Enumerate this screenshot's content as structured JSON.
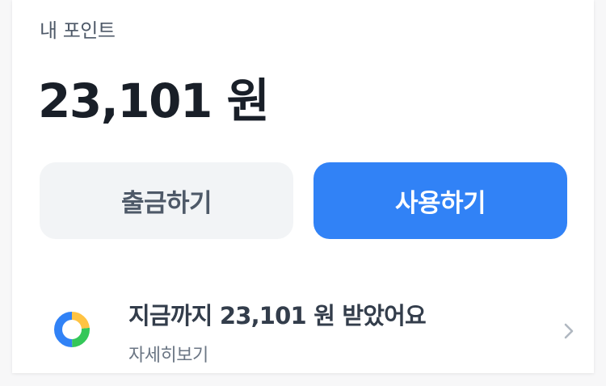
{
  "points": {
    "label": "내 포인트",
    "amount": "23,101 원"
  },
  "actions": {
    "withdraw_label": "출금하기",
    "use_label": "사용하기"
  },
  "summary": {
    "title": "지금까지 23,101 원 받았어요",
    "subtitle": "자세히보기",
    "icon": "donut-chart-icon",
    "chevron_icon": "chevron-right-icon"
  },
  "colors": {
    "primary": "#3182f6",
    "secondary_button": "#f2f4f6",
    "text_dark": "#191f28",
    "text_muted": "#6b7684",
    "donut_blue": "#3182f6",
    "donut_green": "#34c759",
    "donut_yellow": "#ffc342"
  }
}
